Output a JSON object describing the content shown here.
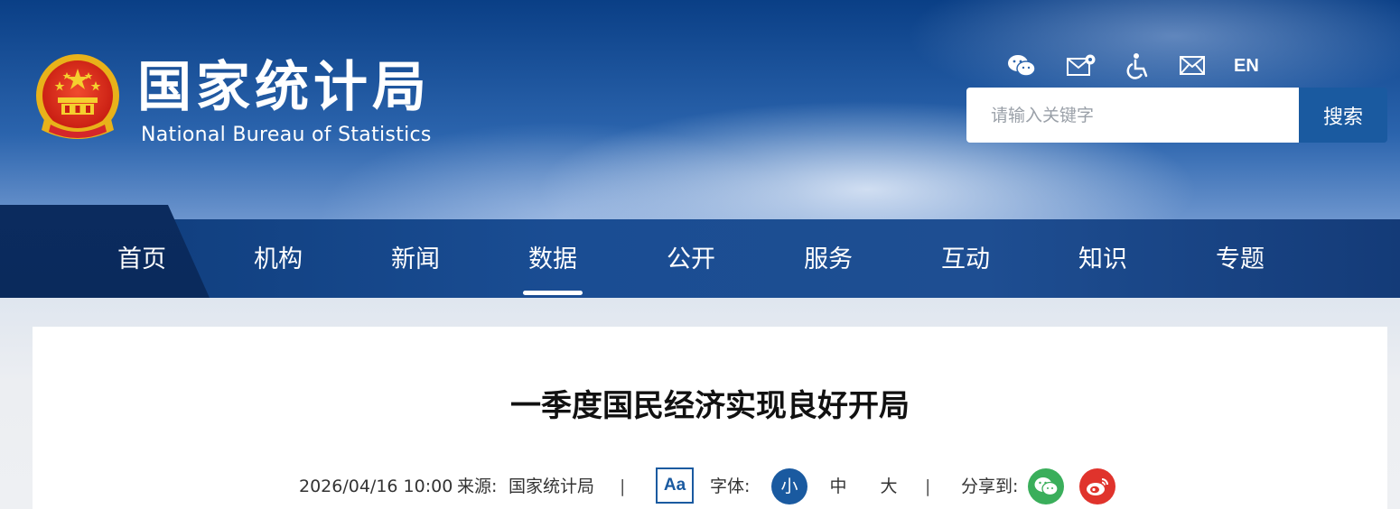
{
  "header": {
    "logo_cn": "国家统计局",
    "logo_en": "National Bureau of Statistics",
    "tools": [
      {
        "icon": "wechat-icon"
      },
      {
        "icon": "mail-settings-icon"
      },
      {
        "icon": "accessibility-icon"
      },
      {
        "icon": "mail-icon"
      }
    ],
    "lang_label": "EN"
  },
  "search": {
    "placeholder": "请输入关键字",
    "button_label": "搜索"
  },
  "nav": {
    "items": [
      {
        "label": "首页"
      },
      {
        "label": "机构"
      },
      {
        "label": "新闻"
      },
      {
        "label": "数据"
      },
      {
        "label": "公开"
      },
      {
        "label": "服务"
      },
      {
        "label": "互动"
      },
      {
        "label": "知识"
      },
      {
        "label": "专题"
      }
    ],
    "active_index": 3
  },
  "article": {
    "title": "一季度国民经济实现良好开局",
    "datetime": "2026/04/16 10:00",
    "source_label": "来源:",
    "source_value": "国家统计局",
    "separator": "|",
    "aa_label": "Aa",
    "font_label": "字体:",
    "font_sizes": {
      "small": "小",
      "medium": "中",
      "large": "大"
    },
    "share_label": "分享到:"
  },
  "colors": {
    "primary": "#1a5aa0",
    "nav_bg": "#1a4d93",
    "wechat_green": "#3aae5b",
    "weibo_red": "#e0332c"
  }
}
